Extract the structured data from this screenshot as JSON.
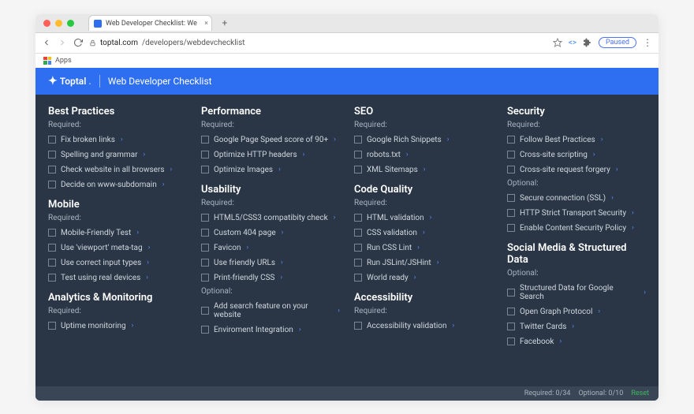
{
  "browser": {
    "tab_title": "Web Developer Checklist: We",
    "url_host": "toptal.com",
    "url_path": "/developers/webdevchecklist",
    "paused_label": "Paused",
    "apps_label": "Apps",
    "new_tab": "+"
  },
  "header": {
    "brand": "Toptal",
    "page_title": "Web Developer Checklist"
  },
  "columns": [
    {
      "sections": [
        {
          "title": "Best Practices",
          "label": "Required:",
          "items": [
            "Fix broken links",
            "Spelling and grammar",
            "Check website in all browsers",
            "Decide on www-subdomain"
          ]
        },
        {
          "title": "Mobile",
          "label": "Required:",
          "items": [
            "Mobile-Friendly Test",
            "Use 'viewport' meta-tag",
            "Use correct input types",
            "Test using real devices"
          ]
        },
        {
          "title": "Analytics & Monitoring",
          "label": "Required:",
          "items": [
            "Uptime monitoring"
          ]
        }
      ]
    },
    {
      "sections": [
        {
          "title": "Performance",
          "label": "Required:",
          "items": [
            "Google Page Speed score of 90+",
            "Optimize HTTP headers",
            "Optimize Images"
          ]
        },
        {
          "title": "Usability",
          "label": "Required:",
          "items": [
            "HTML5/CSS3 compatibity check",
            "Custom 404 page",
            "Favicon",
            "Use friendly URLs",
            "Print-friendly CSS"
          ]
        },
        {
          "title": "",
          "label": "Optional:",
          "items": [
            "Add search feature on your website",
            "Enviroment Integration"
          ]
        }
      ]
    },
    {
      "sections": [
        {
          "title": "SEO",
          "label": "Required:",
          "items": [
            "Google Rich Snippets",
            "robots.txt",
            "XML Sitemaps"
          ]
        },
        {
          "title": "Code Quality",
          "label": "Required:",
          "items": [
            "HTML validation",
            "CSS validation",
            "Run CSS Lint",
            "Run JSLint/JSHint",
            "World ready"
          ]
        },
        {
          "title": "Accessibility",
          "label": "Required:",
          "items": [
            "Accessibility validation"
          ]
        }
      ]
    },
    {
      "sections": [
        {
          "title": "Security",
          "label": "Required:",
          "items": [
            "Follow Best Practices",
            "Cross-site scripting",
            "Cross-site request forgery"
          ]
        },
        {
          "title": "",
          "label": "Optional:",
          "items": [
            "Secure connection (SSL)",
            "HTTP Strict Transport Security",
            "Enable Content Security Policy"
          ]
        },
        {
          "title": "Social Media & Structured Data",
          "label": "Optional:",
          "items": [
            "Structured Data for Google Search",
            "Open Graph Protocol",
            "Twitter Cards",
            "Facebook"
          ]
        }
      ]
    }
  ],
  "footer": {
    "required": "Required: 0/34",
    "optional": "Optional: 0/10",
    "reset": "Reset"
  }
}
